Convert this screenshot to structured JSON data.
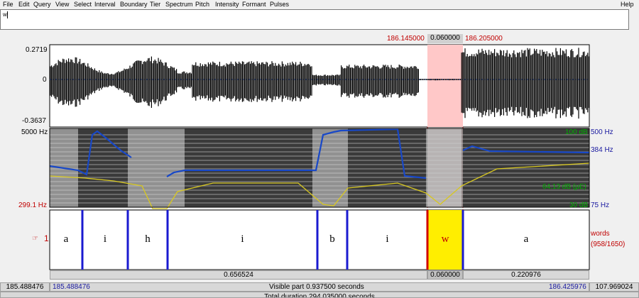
{
  "menu": [
    "File",
    "Edit",
    "Query",
    "View",
    "Select",
    "Interval",
    "Boundary",
    "Tier",
    "Spectrum",
    "Pitch",
    "Intensity",
    "Formant",
    "Pulses"
  ],
  "help_label": "Help",
  "text_field_value": "w",
  "selection": {
    "start": "186.145000",
    "duration": "0.060000",
    "end": "186.205000"
  },
  "waveform": {
    "max": "0.2719",
    "zero": "0",
    "min": "-0.3637"
  },
  "spectrogram": {
    "freq_top": "5000 Hz",
    "pitch_floor": "299.1 Hz",
    "intensity_max": "100 dB",
    "intensity_value": "64.13 dB (μE)",
    "intensity_min": "30 dB",
    "pitch_top": "500 Hz",
    "pitch_value": "384 Hz",
    "pitch_bottom": "75 Hz"
  },
  "tier": {
    "number": "1",
    "name": "words",
    "count": "(958/1650)",
    "segments": [
      "a",
      "i",
      "h",
      "i",
      "b",
      "i",
      "w",
      "a"
    ]
  },
  "durations": {
    "left": "0.656524",
    "selected": "0.060000",
    "right": "0.220976"
  },
  "bottom": {
    "window_start": "185.488476",
    "visible_start": "185.488476",
    "visible_label": "Visible part 0.937500 seconds",
    "visible_end": "186.425976",
    "window_end": "107.969024",
    "total_label": "Total duration 294.035000 seconds"
  },
  "colors": {
    "selection": "#ffc8c8",
    "pitch": "#1848c8",
    "intensity_curve": "#d8c820",
    "selected_segment": "#ffee00",
    "boundary": "#1a1ad0"
  }
}
